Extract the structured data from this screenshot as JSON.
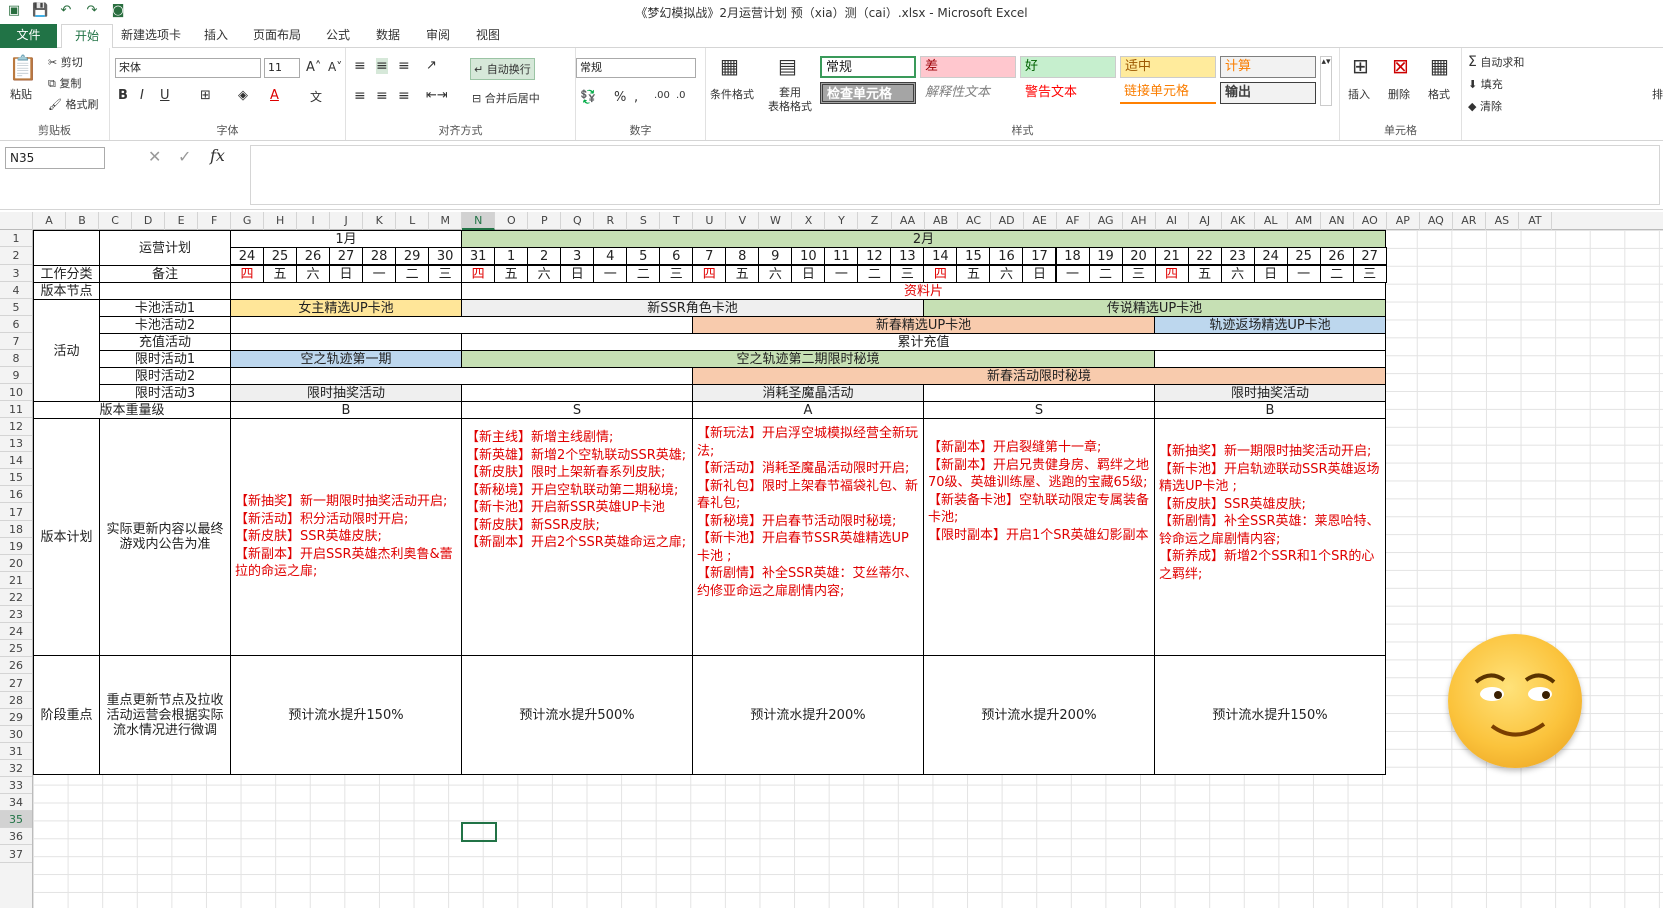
{
  "window": {
    "title": "《梦幻模拟战》2月运营计划 预（xia）测（cai）.xlsx - Microsoft Excel"
  },
  "tabs": [
    "文件",
    "开始",
    "新建选项卡",
    "插入",
    "页面布局",
    "公式",
    "数据",
    "审阅",
    "视图"
  ],
  "ribbon": {
    "clipboard": {
      "label": "剪贴板",
      "paste": "粘贴",
      "cut": "剪切",
      "copy": "复制",
      "painter": "格式刷"
    },
    "font": {
      "label": "字体",
      "name": "宋体",
      "size": "11"
    },
    "align": {
      "label": "对齐方式",
      "wrap": "自动换行",
      "merge": "合并后居中"
    },
    "number": {
      "label": "数字",
      "format": "常规"
    },
    "styles": {
      "label": "样式",
      "cond": "条件格式",
      "table": "套用\n表格格式",
      "normal": "常规",
      "bad": "差",
      "good": "好",
      "neutral": "适中",
      "calc": "计算",
      "check": "检查单元格",
      "explain": "解释性文本",
      "warn": "警告文本",
      "link": "链接单元格",
      "output": "输出"
    },
    "cells": {
      "label": "单元格",
      "insert": "插入",
      "delete": "删除",
      "format": "格式"
    },
    "edit": {
      "autosum": "自动求和",
      "fill": "填充",
      "clear": "清除",
      "sort": "排"
    }
  },
  "formula_bar": {
    "name_box": "N35",
    "fx": "fx",
    "content": ""
  },
  "columns": [
    "A",
    "B",
    "C",
    "D",
    "E",
    "F",
    "G",
    "H",
    "I",
    "J",
    "K",
    "L",
    "M",
    "N",
    "O",
    "P",
    "Q",
    "R",
    "S",
    "T",
    "U",
    "V",
    "W",
    "X",
    "Y",
    "Z",
    "AA",
    "AB",
    "AC",
    "AD",
    "AE",
    "AF",
    "AG",
    "AH",
    "AI",
    "AJ",
    "AK",
    "AL",
    "AM",
    "AN",
    "AO",
    "AP",
    "AQ",
    "AR",
    "AS",
    "AT"
  ],
  "rows": [
    "1",
    "2",
    "3",
    "4",
    "5",
    "6",
    "7",
    "8",
    "9",
    "10",
    "11",
    "12",
    "13",
    "14",
    "15",
    "16",
    "17",
    "18",
    "19",
    "20",
    "21",
    "22",
    "23",
    "24",
    "25",
    "26",
    "27",
    "28",
    "29",
    "30",
    "31",
    "32",
    "33",
    "34",
    "35",
    "36",
    "37"
  ],
  "sheet": {
    "title": "运营计划",
    "jan": "1月",
    "feb": "2月",
    "work_type": "工作分类",
    "note": "备注",
    "version_node": "版本节点",
    "material": "资料片",
    "dates": [
      "24",
      "25",
      "26",
      "27",
      "28",
      "29",
      "30",
      "31",
      "1",
      "2",
      "3",
      "4",
      "5",
      "6",
      "7",
      "8",
      "9",
      "10",
      "11",
      "12",
      "13",
      "14",
      "15",
      "16",
      "17",
      "18",
      "19",
      "20",
      "21",
      "22",
      "23",
      "24",
      "25",
      "26",
      "27"
    ],
    "weekdays": [
      "四",
      "五",
      "六",
      "日",
      "一",
      "二",
      "三",
      "四",
      "五",
      "六",
      "日",
      "一",
      "二",
      "三",
      "四",
      "五",
      "六",
      "日",
      "一",
      "二",
      "三",
      "四",
      "五",
      "六",
      "日",
      "一",
      "二",
      "三",
      "四",
      "五",
      "六",
      "日",
      "一",
      "二",
      "三"
    ],
    "activity": "活动",
    "sub": [
      "卡池活动1",
      "卡池活动2",
      "充值活动",
      "限时活动1",
      "限时活动2",
      "限时活动3"
    ],
    "bars": {
      "pool1_a": "女主精选UP卡池",
      "pool1_b": "新SSR角色卡池",
      "pool1_c": "传说精选UP卡池",
      "pool2_a": "新春精选UP卡池",
      "pool2_b": "轨迹返场精选UP卡池",
      "recharge": "累计充值",
      "lim1_a": "空之轨迹第一期",
      "lim1_b": "空之轨迹第二期限时秘境",
      "lim2": "新春活动限时秘境",
      "lim3_a": "限时抽奖活动",
      "lim3_b": "消耗圣魔晶活动",
      "lim3_c": "限时抽奖活动"
    },
    "weight_label": "版本重量级",
    "weights": [
      "B",
      "S",
      "A",
      "S",
      "B"
    ],
    "plan_label": "版本计划",
    "plan_note": "实际更新内容以最终游戏内公告为准",
    "plans": [
      "【新抽奖】新一期限时抽奖活动开启;\n【新活动】积分活动限时开启;\n【新皮肤】SSR英雄皮肤;\n【新副本】开启SSR英雄杰利奥鲁&蕾拉的命运之扉;",
      "【新主线】新增主线剧情;\n【新英雄】新增2个空轨联动SSR英雄;\n【新皮肤】限时上架新春系列皮肤;\n【新秘境】开启空轨联动第二期秘境;\n【新卡池】开启新SSR英雄UP卡池\n【新皮肤】新SSR皮肤;\n【新副本】开启2个SSR英雄命运之扉;",
      "【新玩法】开启浮空城模拟经营全新玩法;\n【新活动】消耗圣魔晶活动限时开启;\n【新礼包】限时上架春节福袋礼包、新春礼包;\n【新秘境】开启春节活动限时秘境;\n【新卡池】开启春节SSR英雄精选UP卡池 ;\n【新剧情】补全SSR英雄：艾丝蒂尔、约修亚命运之扉剧情内容;",
      "【新副本】开启裂缝第十一章;\n【新副本】开启兄贵健身房、羁绊之地70级、英雄训练屋、逃跑的宝藏65级;\n【新装备卡池】空轨联动限定专属装备卡池;\n【限时副本】开启1个SR英雄幻影副本",
      "【新抽奖】新一期限时抽奖活动开启;\n【新卡池】开启轨迹联动SSR英雄返场精选UP卡池 ;\n【新皮肤】SSR英雄皮肤;\n【新剧情】补全SSR英雄：莱恩哈特、铃命运之扉剧情内容;\n【新养成】新增2个SSR和1个SR的心之羁绊;"
    ],
    "stage_label": "阶段重点",
    "stage_note": "重点更新节点及拉收活动运营会根据实际流水情况进行微调",
    "stages": [
      "预计流水提升150%",
      "预计流水提升500%",
      "预计流水提升200%",
      "预计流水提升200%",
      "预计流水提升150%"
    ]
  },
  "colors": {
    "accent": "#217346",
    "red": "#e00000",
    "yellow": "#ffe699",
    "green": "#c6e0b4",
    "orange": "#f8cbad",
    "blue": "#bdd7ee",
    "gray": "#efefef"
  }
}
